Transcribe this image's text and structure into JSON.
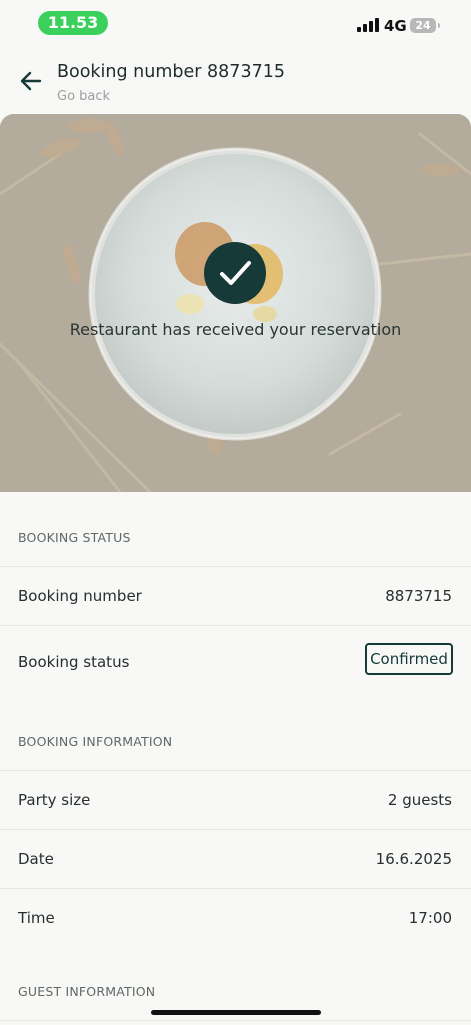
{
  "status_bar": {
    "time": "11.53",
    "network": "4G",
    "battery": "24"
  },
  "header": {
    "title": "Booking number 8873715",
    "back_label": "Go back"
  },
  "hero": {
    "message": "Restaurant has received your reservation"
  },
  "booking_status": {
    "section_title": "BOOKING STATUS",
    "number_label": "Booking number",
    "number_value": "8873715",
    "status_label": "Booking status",
    "status_value": "Confirmed"
  },
  "booking_information": {
    "section_title": "BOOKING INFORMATION",
    "party_label": "Party size",
    "party_value": "2 guests",
    "date_label": "Date",
    "date_value": "16.6.2025",
    "time_label": "Time",
    "time_value": "17:00"
  },
  "guest_information": {
    "section_title": "GUEST INFORMATION"
  },
  "colors": {
    "accent": "#153a38",
    "time_pill": "#3bd05c",
    "background": "#f8f8f6"
  }
}
